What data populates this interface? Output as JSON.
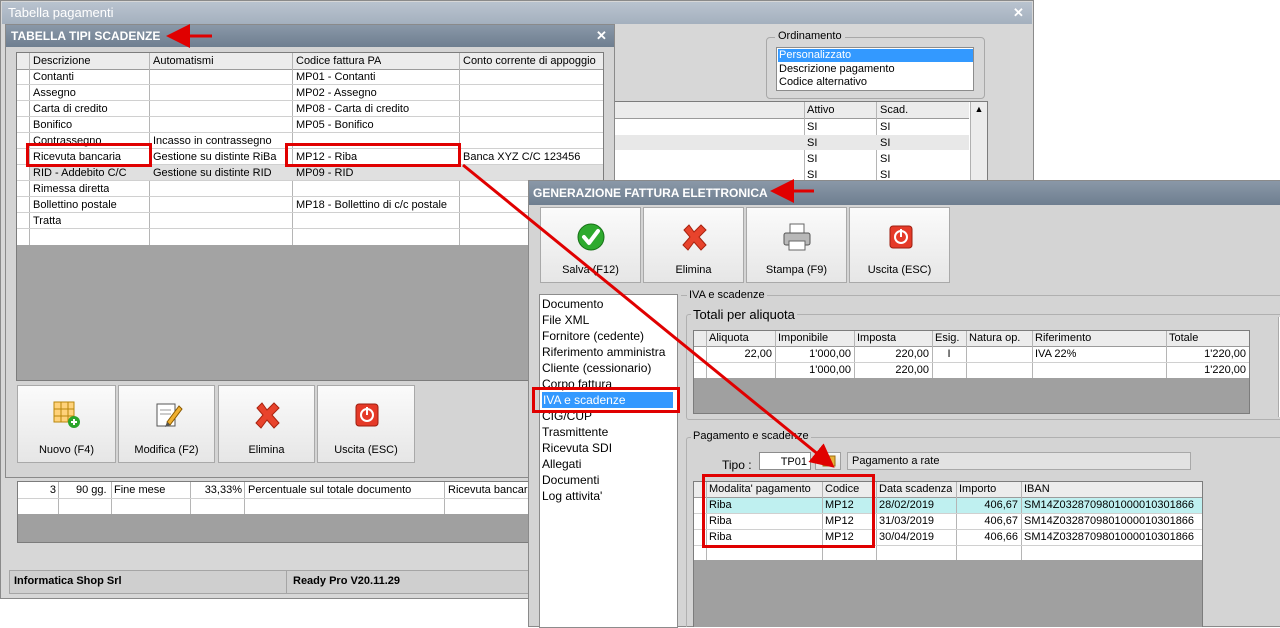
{
  "bg_window": {
    "title": "Tabella pagamenti",
    "ordinamento": {
      "label": "Ordinamento",
      "options": [
        "Personalizzato",
        "Descrizione pagamento",
        "Codice alternativo"
      ]
    },
    "right_grid": {
      "headers": [
        "Attivo",
        "Scad."
      ],
      "rows": [
        [
          "SI",
          "SI"
        ],
        [
          "SI",
          "SI"
        ],
        [
          "SI",
          "SI"
        ],
        [
          "SI",
          "SI"
        ]
      ]
    },
    "lower_row": [
      "3",
      "90 gg.",
      "Fine mese",
      "33,33%",
      "Percentuale sul totale documento",
      "Ricevuta bancaria"
    ],
    "status_company": "Informatica Shop Srl",
    "status_version": "Ready Pro V20.11.29"
  },
  "tipi_window": {
    "title": "TABELLA TIPI SCADENZE",
    "headers": [
      "Descrizione",
      "Automatismi",
      "Codice fattura PA",
      "Conto corrente di appoggio"
    ],
    "rows": [
      [
        "Contanti",
        "",
        "MP01 - Contanti",
        ""
      ],
      [
        "Assegno",
        "",
        "MP02 - Assegno",
        ""
      ],
      [
        "Carta di credito",
        "",
        "MP08 - Carta di credito",
        ""
      ],
      [
        "Bonifico",
        "",
        "MP05 - Bonifico",
        ""
      ],
      [
        "Contrassegno",
        "Incasso in contrassegno",
        "",
        ""
      ],
      [
        "Ricevuta bancaria",
        "Gestione su distinte RiBa",
        "MP12 - Riba",
        "Banca XYZ C/C 123456"
      ],
      [
        "RID - Addebito C/C",
        "Gestione su distinte RID",
        "MP09 - RID",
        ""
      ],
      [
        "Rimessa diretta",
        "",
        "",
        ""
      ],
      [
        "Bollettino postale",
        "",
        "MP18 - Bollettino di c/c postale",
        ""
      ],
      [
        "Tratta",
        "",
        "",
        ""
      ]
    ],
    "buttons": {
      "nuovo": "Nuovo (F4)",
      "modifica": "Modifica (F2)",
      "elimina": "Elimina",
      "uscita": "Uscita (ESC)"
    }
  },
  "fe_window": {
    "title": "GENERAZIONE FATTURA ELETTRONICA",
    "toolbar": {
      "salva": "Salva (F12)",
      "elimina": "Elimina",
      "stampa": "Stampa (F9)",
      "uscita": "Uscita (ESC)"
    },
    "nav": [
      "Documento",
      "File XML",
      "Fornitore (cedente)",
      "Riferimento amministra",
      "Cliente (cessionario)",
      "Corpo fattura",
      "IVA e scadenze",
      "CIG/CUP",
      "Trasmittente",
      "Ricevuta SDI",
      "Allegati",
      "Documenti",
      "Log attivita'"
    ],
    "section_title": "IVA e scadenze",
    "totali": {
      "title": "Totali per aliquota",
      "headers": [
        "Aliquota",
        "Imponibile",
        "Imposta",
        "Esig.",
        "Natura op.",
        "Riferimento",
        "Totale"
      ],
      "rows": [
        [
          "22,00",
          "1'000,00",
          "220,00",
          "I",
          "",
          "IVA 22%",
          "1'220,00"
        ],
        [
          "",
          "1'000,00",
          "220,00",
          "",
          "",
          "",
          "1'220,00"
        ]
      ]
    },
    "pagamento": {
      "title": "Pagamento e scadenze",
      "tipo_label": "Tipo :",
      "tipo_value": "TP01",
      "tipo_desc": "Pagamento a rate",
      "headers": [
        "Modalita' pagamento",
        "Codice",
        "Data scadenza",
        "Importo",
        "IBAN"
      ],
      "rows": [
        [
          "Riba",
          "MP12",
          "28/02/2019",
          "406,67",
          "SM14Z0328709801000010301866"
        ],
        [
          "Riba",
          "MP12",
          "31/03/2019",
          "406,67",
          "SM14Z0328709801000010301866"
        ],
        [
          "Riba",
          "MP12",
          "30/04/2019",
          "406,66",
          "SM14Z0328709801000010301866"
        ]
      ]
    }
  },
  "colors": {
    "accent_red": "#e00000",
    "selection_blue": "#3399ff",
    "row_highlight": "#bff0f0"
  }
}
